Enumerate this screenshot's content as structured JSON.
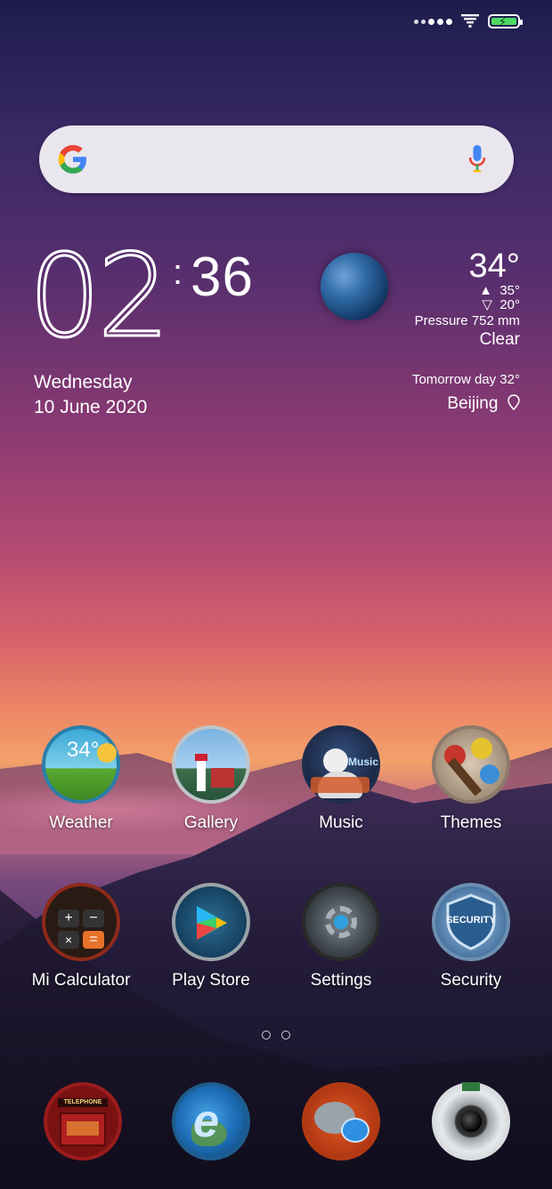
{
  "status_bar": {
    "signal_icon": "signal-dots-icon",
    "wifi_icon": "wifi-icon",
    "battery_icon": "battery-charging-icon",
    "battery_color": "#4cd964"
  },
  "search": {
    "logo_icon": "google-g-icon",
    "mic_icon": "microphone-icon"
  },
  "clock": {
    "hours": "02",
    "separator": ":",
    "minutes": "36",
    "weekday": "Wednesday",
    "date": "10 June 2020"
  },
  "weather": {
    "icon": "planet-icon",
    "temperature": "34°",
    "high": "35°",
    "low": "20°",
    "high_icon": "triangle-up-icon",
    "low_icon": "triangle-down-icon",
    "pressure": "Pressure 752 mm",
    "condition": "Clear",
    "tomorrow": "Tomorrow day 32°",
    "city": "Beijing",
    "location_icon": "location-pin-icon"
  },
  "apps": [
    {
      "label": "Weather",
      "icon": "weather-app-icon",
      "icon_text": "34°"
    },
    {
      "label": "Gallery",
      "icon": "gallery-app-icon"
    },
    {
      "label": "Music",
      "icon": "music-app-icon",
      "icon_text": "Music"
    },
    {
      "label": "Themes",
      "icon": "themes-app-icon"
    },
    {
      "label": "Mi Calculator",
      "icon": "calculator-app-icon"
    },
    {
      "label": "Play Store",
      "icon": "play-store-app-icon"
    },
    {
      "label": "Settings",
      "icon": "settings-app-icon"
    },
    {
      "label": "Security",
      "icon": "security-app-icon",
      "icon_text": "SECURITY"
    }
  ],
  "page_indicator": {
    "pages": 2
  },
  "dock": [
    {
      "icon": "phone-app-icon",
      "icon_text": "TELEPHONE"
    },
    {
      "icon": "browser-app-icon"
    },
    {
      "icon": "messaging-app-icon"
    },
    {
      "icon": "camera-app-icon"
    }
  ]
}
